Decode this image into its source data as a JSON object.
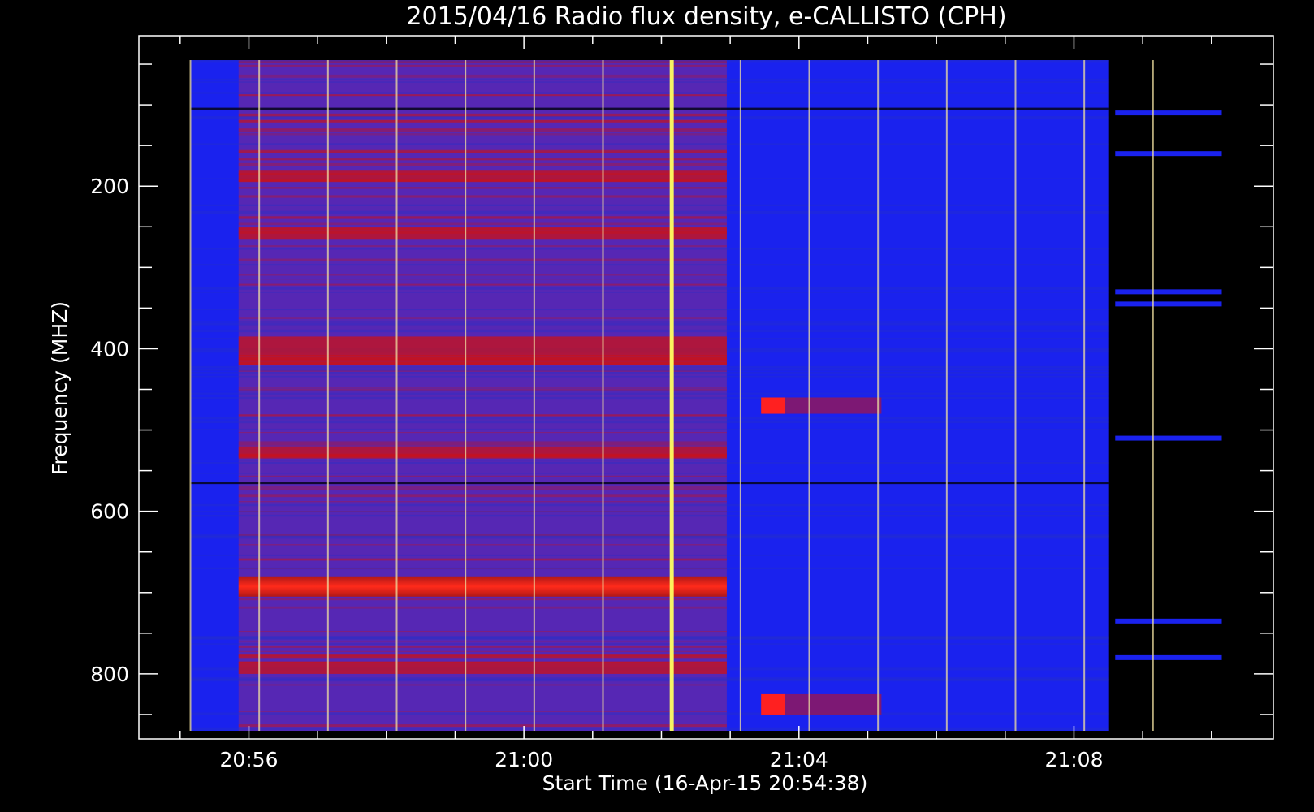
{
  "chart_data": {
    "type": "heatmap",
    "title": "2015/04/16  Radio flux density, e-CALLISTO (CPH)",
    "xlabel": "Start Time (16-Apr-15 20:54:38)",
    "ylabel": "Frequency (MHZ)",
    "x_ticks": [
      "20:56",
      "21:00",
      "21:04",
      "21:08"
    ],
    "y_ticks": [
      "200",
      "400",
      "600",
      "800"
    ],
    "x_tick_values_min": [
      0,
      4,
      8,
      12
    ],
    "y_tick_values": [
      200,
      400,
      600,
      800
    ],
    "xlim_min": [
      -1.6,
      14.9
    ],
    "ylim": [
      880,
      15
    ],
    "data_extent": {
      "x_min": [
        -0.85,
        14.15
      ],
      "y_mhz": [
        45,
        870
      ]
    },
    "gap_start_min": 12.5,
    "gap_end_min": 12.6,
    "low_band_end_min": 12.5,
    "colors": {
      "background": "#000000",
      "low": "#1a22ee",
      "mid": "#5a28b0",
      "high": "#d01010",
      "peak": "#ffff60"
    },
    "features": {
      "elevated_region": {
        "t_start_min": -0.15,
        "t_end_min": 6.95
      },
      "red_bands_mhz": [
        [
          180,
          195
        ],
        [
          250,
          265
        ],
        [
          385,
          420
        ],
        [
          520,
          535
        ],
        [
          680,
          705
        ],
        [
          785,
          800
        ]
      ],
      "dark_lines_mhz": [
        105,
        565
      ],
      "spikes_min": [
        -0.85,
        0.15,
        1.15,
        2.15,
        3.15,
        4.15,
        5.15,
        6.15,
        7.15,
        8.15,
        9.15,
        10.15,
        11.15,
        12.15,
        13.15
      ],
      "strong_spike_min": 6.15,
      "bursts": [
        {
          "t_start_min": 7.45,
          "t_end_min": 9.2,
          "mhz": [
            460,
            480
          ]
        },
        {
          "t_start_min": 7.45,
          "t_end_min": 9.2,
          "mhz": [
            825,
            850
          ]
        }
      ],
      "late_lines_mhz": [
        110,
        160,
        330,
        345,
        510,
        735,
        780
      ]
    }
  }
}
